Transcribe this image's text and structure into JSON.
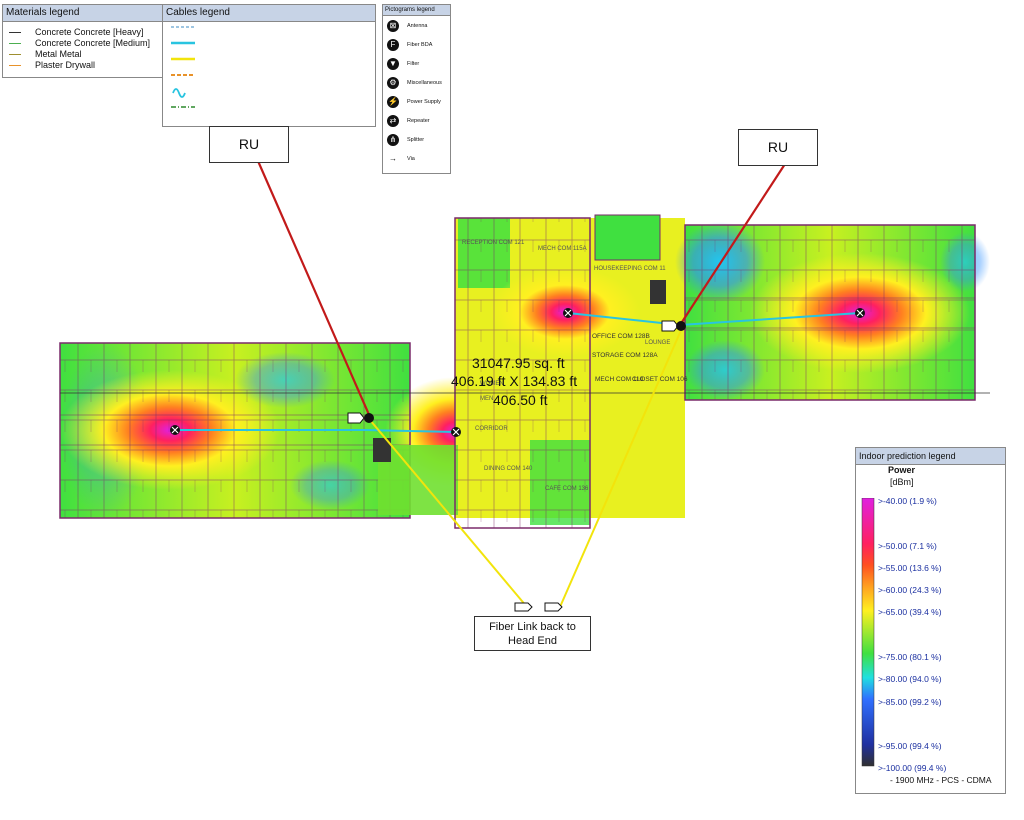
{
  "materials_legend": {
    "title": "Materials legend",
    "items": [
      {
        "label": "Concrete Concrete [Heavy]",
        "color": "#333333"
      },
      {
        "label": "Concrete Concrete [Medium]",
        "color": "#4caf50"
      },
      {
        "label": "Metal Metal",
        "color": "#9e8f2f"
      },
      {
        "label": "Plaster Drywall",
        "color": "#e8922a"
      }
    ]
  },
  "cables_legend": {
    "title": "Cables legend",
    "items": [
      {
        "style": "dashed",
        "color": "#7fb3d9"
      },
      {
        "style": "solid",
        "color": "#29c4e0"
      },
      {
        "style": "solid",
        "color": "#f2e40c"
      },
      {
        "style": "dashed",
        "color": "#e8922a"
      },
      {
        "style": "wave",
        "color": "#29c4e0"
      },
      {
        "style": "dashdot",
        "color": "#2d8a2d"
      }
    ]
  },
  "pictograms_legend": {
    "title": "Pictograms legend",
    "items": [
      {
        "label": "Antenna",
        "icon": "antenna-icon",
        "glyph": "⊠"
      },
      {
        "label": "Fiber BDA",
        "icon": "fiber-bda-icon",
        "glyph": "F"
      },
      {
        "label": "Filter",
        "icon": "filter-icon",
        "glyph": "▼"
      },
      {
        "label": "Miscellaneous",
        "icon": "miscellaneous-icon",
        "glyph": "⚙"
      },
      {
        "label": "Power Supply",
        "icon": "power-supply-icon",
        "glyph": "⚡"
      },
      {
        "label": "Repeater",
        "icon": "repeater-icon",
        "glyph": "⇄"
      },
      {
        "label": "Splitter",
        "icon": "splitter-icon",
        "glyph": "⋔"
      },
      {
        "label": "Via",
        "icon": "via-icon",
        "glyph": "→"
      }
    ]
  },
  "annotations": {
    "ru_left": "RU",
    "ru_right": "RU",
    "fiber_link_line1": "Fiber Link back to",
    "fiber_link_line2": "Head End",
    "area": "31047.95 sq. ft",
    "dimensions": "406.19 ft  X  134.83 ft",
    "length": "406.50 ft"
  },
  "room_labels": [
    "RECEPTION COM 121",
    "MECH COM 115A",
    "HOUSEKEEPING COM 11",
    "OFFICE COM 128B",
    "STORAGE COM 128A",
    "MECH COM 110",
    "CLOSET COM 106",
    "LOUNGE",
    "DINING COM 140",
    "CAFE COM 136",
    "WOMEN",
    "MEN",
    "CORRIDOR"
  ],
  "indoor_prediction_legend": {
    "title": "Indoor prediction legend",
    "measure": "Power",
    "unit": "[dBm]",
    "levels": [
      {
        "label": ">-40.00 (1.9 %)",
        "color": "#e020e0"
      },
      {
        "label": ">-50.00 (7.1 %)",
        "color": "#ff2050"
      },
      {
        "label": ">-55.00 (13.6 %)",
        "color": "#ff5020"
      },
      {
        "label": ">-60.00 (24.3 %)",
        "color": "#ffa020"
      },
      {
        "label": ">-65.00 (39.4 %)",
        "color": "#fff020"
      },
      {
        "label": ">-75.00 (80.1 %)",
        "color": "#40e040"
      },
      {
        "label": ">-80.00 (94.0 %)",
        "color": "#20e0e0"
      },
      {
        "label": ">-85.00 (99.2 %)",
        "color": "#3070ff"
      },
      {
        "label": ">-95.00 (99.4 %)",
        "color": "#2030a0"
      },
      {
        "label": ">-100.00 (99.4 %)",
        "color": "#303030"
      }
    ],
    "footnote": "- 1900 MHz - PCS - CDMA"
  },
  "colors": {
    "ru_line": "#c21a1a",
    "fiber_line": "#f2e40c",
    "cable": "#29c4e0",
    "wall": "#7a2a6a"
  }
}
